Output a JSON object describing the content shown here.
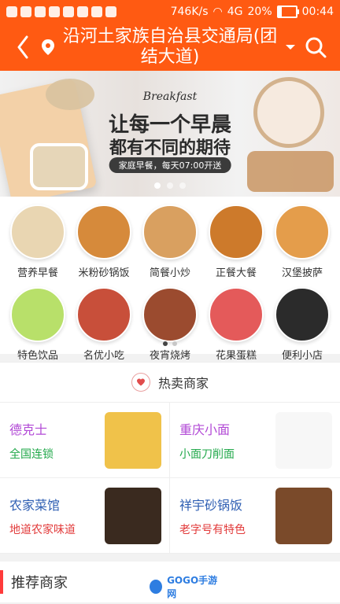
{
  "status": {
    "speed": "746K/s",
    "signal": "4G",
    "battery_text": "20%",
    "battery_level": 0.2,
    "time": "00:44"
  },
  "header": {
    "title": "沿河土家族自治县交通局(团结大道)",
    "title_line1": "沿河土家族自治县交通局(团",
    "title_line2": "结大道)"
  },
  "banner": {
    "eng": "Breakfast",
    "line1": "让每一个早晨",
    "line2": "都有不同的期待",
    "pill": "家庭早餐，每天07:00开送",
    "dots": 3,
    "active_index": 0
  },
  "categories": [
    {
      "label": "营养早餐",
      "color": "#e9d6b2"
    },
    {
      "label": "米粉砂锅饭",
      "color": "#d68a3b"
    },
    {
      "label": "简餐小炒",
      "color": "#d9a060"
    },
    {
      "label": "正餐大餐",
      "color": "#cd7a2b"
    },
    {
      "label": "汉堡披萨",
      "color": "#e49d4b"
    },
    {
      "label": "特色饮品",
      "color": "#b8e06a"
    },
    {
      "label": "名优小吃",
      "color": "#c84f3a"
    },
    {
      "label": "夜宵烧烤",
      "color": "#9b4b2f"
    },
    {
      "label": "花果蛋糕",
      "color": "#e45a5a"
    },
    {
      "label": "便利小店",
      "color": "#2b2b2b"
    }
  ],
  "hot_section": {
    "title": "热卖商家"
  },
  "merchants": [
    {
      "name": "德克士",
      "tag": "全国连锁",
      "name_color": "#b24ad6",
      "tag_color": "#21a84a",
      "image_color": "#f0c24a"
    },
    {
      "name": "重庆小面",
      "tag": "小面刀削面",
      "name_color": "#b24ad6",
      "tag_color": "#21a84a",
      "image_color": "#f7f7f7"
    },
    {
      "name": "农家菜馆",
      "tag": "地道农家味道",
      "name_color": "#2f5fb3",
      "tag_color": "#e23b3b",
      "image_color": "#3a2a1f"
    },
    {
      "name": "祥宇砂锅饭",
      "tag": "老字号有特色",
      "name_color": "#2f5fb3",
      "tag_color": "#e23b3b",
      "image_color": "#7a4a2a"
    }
  ],
  "recommended": {
    "title": "推荐商家"
  },
  "watermark": {
    "text": "GOGO手游网"
  },
  "colors": {
    "brand": "#ff5a12",
    "accent_red": "#ff3b3b",
    "gray_bg": "#f2f2f2"
  }
}
